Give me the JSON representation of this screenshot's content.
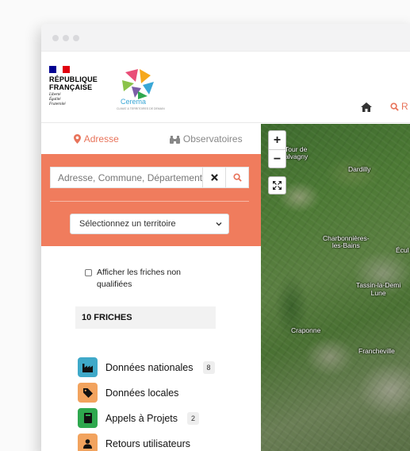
{
  "header": {
    "republic_title_line1": "RÉPUBLIQUE",
    "republic_title_line2": "FRANÇAISE",
    "motto_1": "Liberté",
    "motto_2": "Égalité",
    "motto_3": "Fraternité",
    "cerema_name": "Cerema",
    "cerema_subtitle": "CLIMAT & TERRITOIRES DE DEMAIN",
    "nav_partial": "R"
  },
  "tabs": [
    {
      "label": "Adresse",
      "icon": "map-marker-icon",
      "active": true
    },
    {
      "label": "Observatoires",
      "icon": "binoculars-icon",
      "active": false
    }
  ],
  "search": {
    "placeholder": "Adresse, Commune, Département"
  },
  "territory_select": {
    "selected": "Sélectionnez un territoire"
  },
  "checkbox_unqualified": {
    "label": "Afficher les friches non qualifiées",
    "checked": false
  },
  "results": {
    "count_label": "10 FRICHES",
    "items": [
      {
        "label": "Données nationales",
        "count": "8",
        "color": "#3fa9c9",
        "icon": "factory-icon"
      },
      {
        "label": "Données locales",
        "count": "",
        "color": "#f2a35e",
        "icon": "tag-icon"
      },
      {
        "label": "Appels à Projets",
        "count": "2",
        "color": "#2ea84e",
        "icon": "book-icon"
      },
      {
        "label": "Retours utilisateurs",
        "count": "",
        "color": "#f2a35e",
        "icon": "user-icon"
      }
    ]
  },
  "map": {
    "zoom_in": "+",
    "zoom_out": "−",
    "places": {
      "tour_1": "Tour de",
      "tour_2": "alvagny",
      "dardilly": "Dardilly",
      "charbonnieres_1": "Charbonnières-",
      "charbonnieres_2": "les-Bains",
      "ecully": "Écul",
      "tassin_1": "Tassin-la-Demi",
      "tassin_2": "Lune",
      "craponne": "Craponne",
      "francheville": "Francheville"
    }
  },
  "colors": {
    "accent": "#f07c5d",
    "accent_text": "#e8735a"
  }
}
